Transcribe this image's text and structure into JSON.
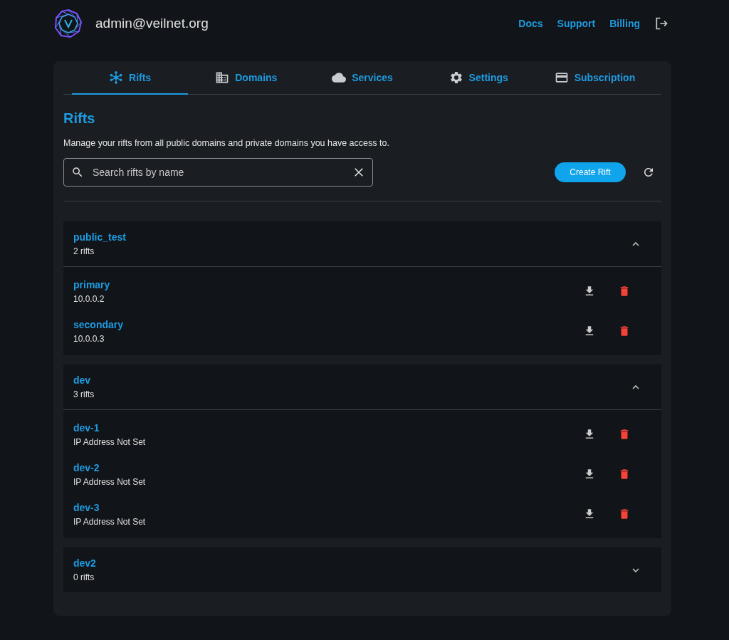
{
  "header": {
    "account": "admin@veilnet.org",
    "links": [
      "Docs",
      "Support",
      "Billing"
    ]
  },
  "tabs": [
    {
      "label": "Rifts",
      "selected": true
    },
    {
      "label": "Domains",
      "selected": false
    },
    {
      "label": "Services",
      "selected": false
    },
    {
      "label": "Settings",
      "selected": false
    },
    {
      "label": "Subscription",
      "selected": false
    }
  ],
  "page": {
    "title": "Rifts",
    "description": "Manage your rifts from all public domains and private domains you have access to.",
    "search": {
      "placeholder": "Search rifts by name"
    },
    "create_button": "Create Rift"
  },
  "groups": [
    {
      "name": "public_test",
      "count": "2 rifts",
      "expanded": true,
      "rifts": [
        {
          "name": "primary",
          "address": "10.0.0.2"
        },
        {
          "name": "secondary",
          "address": "10.0.0.3"
        }
      ]
    },
    {
      "name": "dev",
      "count": "3 rifts",
      "expanded": true,
      "rifts": [
        {
          "name": "dev-1",
          "address": "IP Address Not Set"
        },
        {
          "name": "dev-2",
          "address": "IP Address Not Set"
        },
        {
          "name": "dev-3",
          "address": "IP Address Not Set"
        }
      ]
    },
    {
      "name": "dev2",
      "count": "0 rifts",
      "expanded": false
    }
  ]
}
